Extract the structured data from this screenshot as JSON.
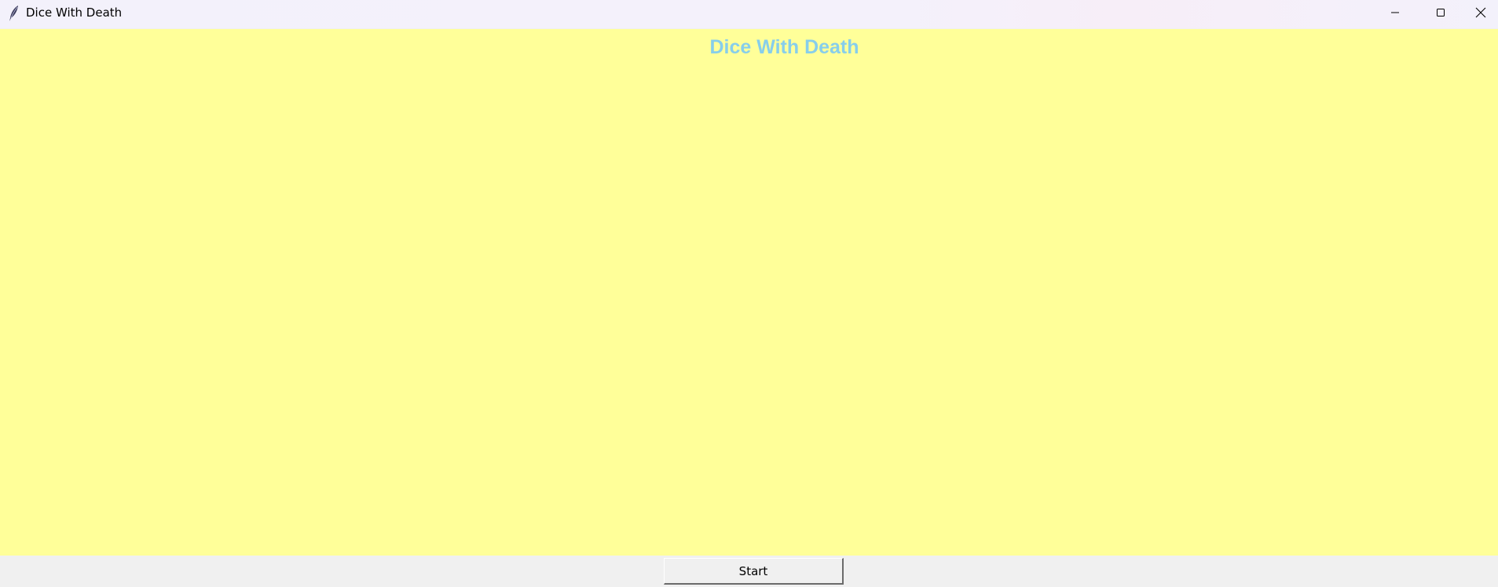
{
  "window": {
    "title": "Dice With Death",
    "icon": "feather-icon",
    "controls": {
      "minimize_icon": "minimize-icon",
      "maximize_icon": "maximize-icon",
      "close_icon": "close-icon"
    }
  },
  "canvas": {
    "background_color": "#ffff99",
    "heading": "Dice With Death",
    "heading_color": "#87ceeb"
  },
  "controls": {
    "start_label": "Start"
  }
}
